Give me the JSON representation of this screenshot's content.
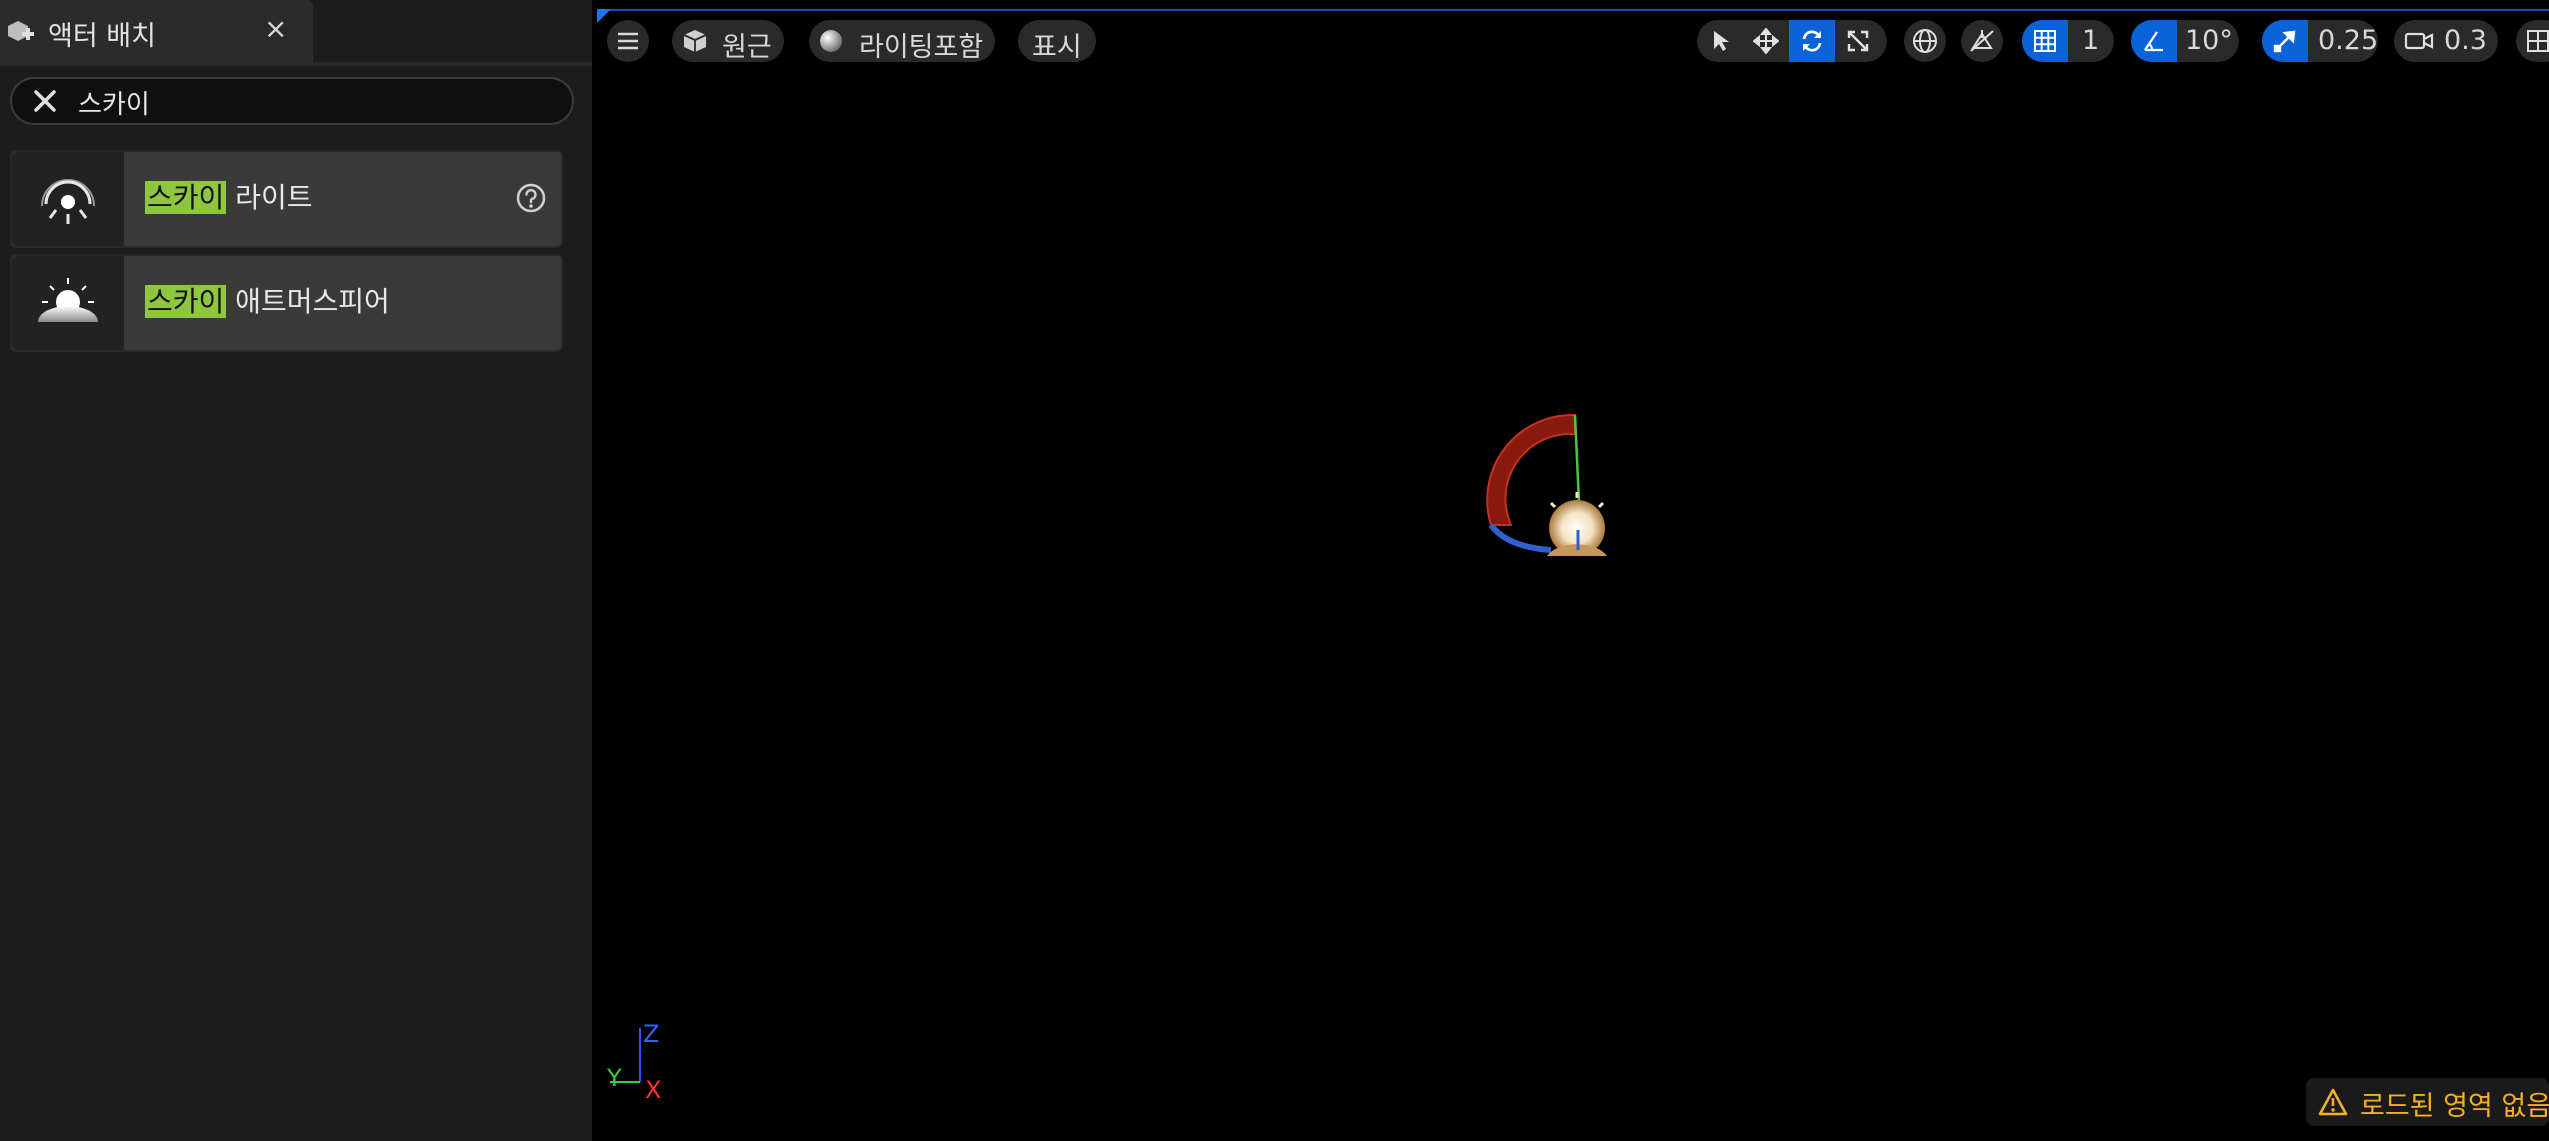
{
  "panel": {
    "tab_title": "액터 배치",
    "close_glyph": "×",
    "search_value": "스카이",
    "results": [
      {
        "highlight": "스카이",
        "rest": " 라이트",
        "icon": "sky-light-icon",
        "has_help": true
      },
      {
        "highlight": "스카이",
        "rest": " 애트머스피어",
        "icon": "sky-atmosphere-icon",
        "has_help": false
      }
    ]
  },
  "viewport": {
    "menu_icon": "hamburger-menu-icon",
    "perspective_label": "원근",
    "lighting_label": "라이팅포함",
    "show_label": "표시",
    "grid_snap_value": "1",
    "rotation_snap_value": "10°",
    "scale_snap_value": "0.25",
    "camera_speed_value": "0.3",
    "warning_text": "로드된 영역 없음",
    "axis_labels": {
      "z": "Z",
      "y": "Y",
      "x": "X"
    },
    "colors": {
      "accent": "#0b63d8",
      "warning": "#f4b021",
      "highlight": "#8ec63f"
    }
  }
}
